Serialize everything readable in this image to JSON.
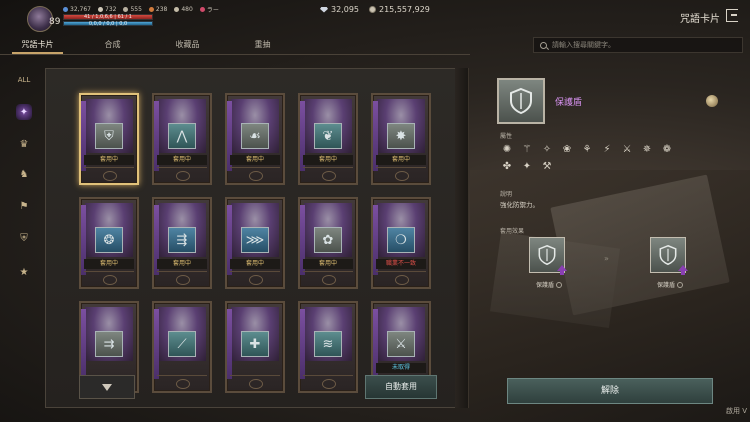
{
  "player": {
    "level": "89",
    "stats": [
      "32,767",
      "732",
      "555",
      "238",
      "480",
      "ラー"
    ],
    "hp_text": "41 / 1,0,6,6 | 61 / 1",
    "mp_text": "0,0,0 / 0,0 | 0,0"
  },
  "currency": {
    "gems": "32,095",
    "silver": "215,557,929"
  },
  "window_title": "咒語卡片",
  "tabs": [
    "咒語卡片",
    "合成",
    "收藏品",
    "重抽"
  ],
  "search": {
    "placeholder": "請輸入搜尋關鍵字。"
  },
  "sidebar": {
    "items": [
      {
        "icon": "all-icon",
        "glyph": "ALL"
      },
      {
        "icon": "purple-crystal-icon",
        "glyph": "✦"
      },
      {
        "icon": "gold-crest-icon",
        "glyph": "♛"
      },
      {
        "icon": "knight-icon",
        "glyph": "♞"
      },
      {
        "icon": "banner-icon",
        "glyph": "⚑"
      },
      {
        "icon": "shield-icon",
        "glyph": "⛨"
      },
      {
        "icon": "star-icon",
        "glyph": "★"
      }
    ]
  },
  "cards": [
    {
      "glyph": "⛨",
      "emblem": "grey",
      "status": "套用中",
      "status_color": "gold",
      "selected": true
    },
    {
      "glyph": "⋀",
      "emblem": "teal",
      "status": "套用中",
      "status_color": "gold"
    },
    {
      "glyph": "☙",
      "emblem": "grey",
      "status": "套用中",
      "status_color": "gold"
    },
    {
      "glyph": "❦",
      "emblem": "teal",
      "status": "套用中",
      "status_color": "gold"
    },
    {
      "glyph": "✸",
      "emblem": "grey",
      "status": "套用中",
      "status_color": "gold"
    },
    {
      "glyph": "❂",
      "emblem": "blue",
      "status": "套用中",
      "status_color": "gold"
    },
    {
      "glyph": "⇶",
      "emblem": "blue",
      "status": "套用中",
      "status_color": "gold"
    },
    {
      "glyph": "⋙",
      "emblem": "blue",
      "status": "套用中",
      "status_color": "gold"
    },
    {
      "glyph": "✿",
      "emblem": "grey",
      "status": "套用中",
      "status_color": "gold"
    },
    {
      "glyph": "❍",
      "emblem": "blue",
      "status": "職業不一致",
      "status_color": "red"
    },
    {
      "glyph": "⇉",
      "emblem": "grey",
      "status": "",
      "status_color": "none"
    },
    {
      "glyph": "⟋",
      "emblem": "teal",
      "status": "",
      "status_color": "none"
    },
    {
      "glyph": "✚",
      "emblem": "teal",
      "status": "",
      "status_color": "none"
    },
    {
      "glyph": "≋",
      "emblem": "teal",
      "status": "",
      "status_color": "none"
    },
    {
      "glyph": "⚔",
      "emblem": "grey",
      "status": "未取得",
      "status_color": "cyan"
    }
  ],
  "buttons": {
    "auto_apply": "自動套用",
    "release": "解除"
  },
  "detail": {
    "name": "保護盾",
    "attr_label": "屬性",
    "attr_icons": [
      "✺",
      "⚚",
      "✧",
      "❀",
      "⚘",
      "⚡",
      "⚔",
      "✵",
      "❁",
      "✤",
      "✦",
      "⚒"
    ],
    "desc_label": "說明",
    "desc_text": "強化防禦力。",
    "effect_label": "套用效果",
    "effect_from": "保護盾",
    "effect_to": "保護盾",
    "arrow": "»"
  },
  "corner_text": "啟用 V"
}
